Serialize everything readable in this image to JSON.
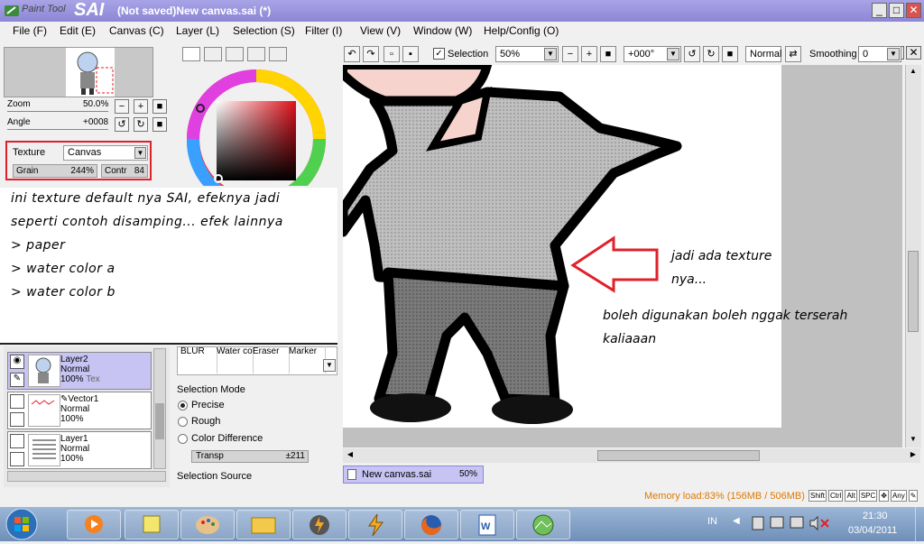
{
  "window": {
    "app_name_small": "Paint Tool",
    "app_name_big": "SAI",
    "title": "(Not saved)New canvas.sai (*)"
  },
  "window_controls": {
    "minimize": "_",
    "maximize": "□",
    "close": "✕"
  },
  "menu": [
    "File (F)",
    "Edit (E)",
    "Canvas (C)",
    "Layer (L)",
    "Selection (S)",
    "Filter (I)",
    "View (V)",
    "Window (W)",
    "Help/Config (O)"
  ],
  "navigator": {
    "zoom_label": "Zoom",
    "zoom_value": "50.0%",
    "angle_label": "Angle",
    "angle_value": "+0008"
  },
  "texture": {
    "label": "Texture",
    "value": "Canvas",
    "grain_label": "Grain",
    "grain_value": "244%",
    "contr_label": "Contr",
    "contr_value": "84"
  },
  "notes": {
    "line1": "ini texture default nya SAI, efeknya jadi",
    "line2": "seperti contoh disamping... efek lainnya",
    "line3": "> paper",
    "line4": "> water color a",
    "line5": "> water color b"
  },
  "layers": [
    {
      "name": "Layer2",
      "mode": "Normal",
      "opacity": "100%",
      "extra": "Tex",
      "selected": true
    },
    {
      "name": "Vector1",
      "mode": "Normal",
      "opacity": "100%",
      "extra": "",
      "selected": false
    },
    {
      "name": "Layer1",
      "mode": "Normal",
      "opacity": "100%",
      "extra": "",
      "selected": false
    }
  ],
  "brushes": [
    "BLUR",
    "Water co",
    "Eraser",
    "Marker"
  ],
  "selection_mode": {
    "title": "Selection Mode",
    "options": [
      "Precise",
      "Rough",
      "Color Difference"
    ],
    "selected": "Precise",
    "transp_label": "Transp",
    "transp_value": "±211",
    "source_title": "Selection Source"
  },
  "toolbar": {
    "selection_label": "Selection",
    "zoom": "50%",
    "angle": "+000°",
    "blend": "Normal",
    "smoothing_label": "Smoothing",
    "smoothing_value": "0"
  },
  "annotations": {
    "arrow_text1": "jadi ada texture",
    "arrow_text2": "nya...",
    "note1": "boleh digunakan boleh nggak terserah",
    "note2": "kaliaaan"
  },
  "canvas_tab": {
    "name": "New canvas.sai",
    "zoom": "50%"
  },
  "status": {
    "memory": "Memory load:83% (156MB / 506MB)",
    "keys": [
      "Shift",
      "Ctrl",
      "Alt",
      "SPC",
      "Any"
    ]
  },
  "taskbar": {
    "lang": "IN",
    "time": "21:30",
    "date": "03/04/2011"
  },
  "colors": {
    "titlebar": "#9a94de",
    "selection": "#c7c4f3",
    "highlight_red": "#e0202a",
    "memory_orange": "#e07800"
  }
}
